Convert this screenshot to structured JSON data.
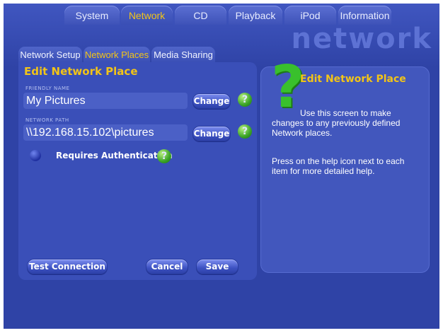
{
  "top_tabs": [
    {
      "label": "System",
      "active": false
    },
    {
      "label": "Network",
      "active": true
    },
    {
      "label": "CD",
      "active": false
    },
    {
      "label": "Playback",
      "active": false
    },
    {
      "label": "iPod",
      "active": false
    },
    {
      "label": "Information",
      "active": false
    }
  ],
  "watermark": "network",
  "sub_tabs": [
    {
      "label": "Network Setup",
      "active": false
    },
    {
      "label": "Network Places",
      "active": true
    },
    {
      "label": "Media Sharing",
      "active": false
    }
  ],
  "form": {
    "title": "Edit Network Place",
    "friendly_name_label": "FRIENDLY NAME",
    "friendly_name_value": "My Pictures",
    "network_path_label": "NETWORK PATH",
    "network_path_value": "\\\\192.168.15.102\\pictures",
    "change_label": "Change",
    "requires_auth_label": "Requires Authentication",
    "test_connection_label": "Test Connection",
    "cancel_label": "Cancel",
    "save_label": "Save"
  },
  "help_panel": {
    "title": "Edit Network Place",
    "paragraph1": "Use this screen to make changes to any previously defined Network places.",
    "paragraph2": "Press on the help icon next to each item for more detailed help."
  },
  "colors": {
    "background": "#2f43a6",
    "accent_yellow": "#f2c418",
    "help_green": "#39c02c"
  },
  "icons": [
    "help-question-icon",
    "radio-button-icon",
    "large-question-mark-icon"
  ]
}
